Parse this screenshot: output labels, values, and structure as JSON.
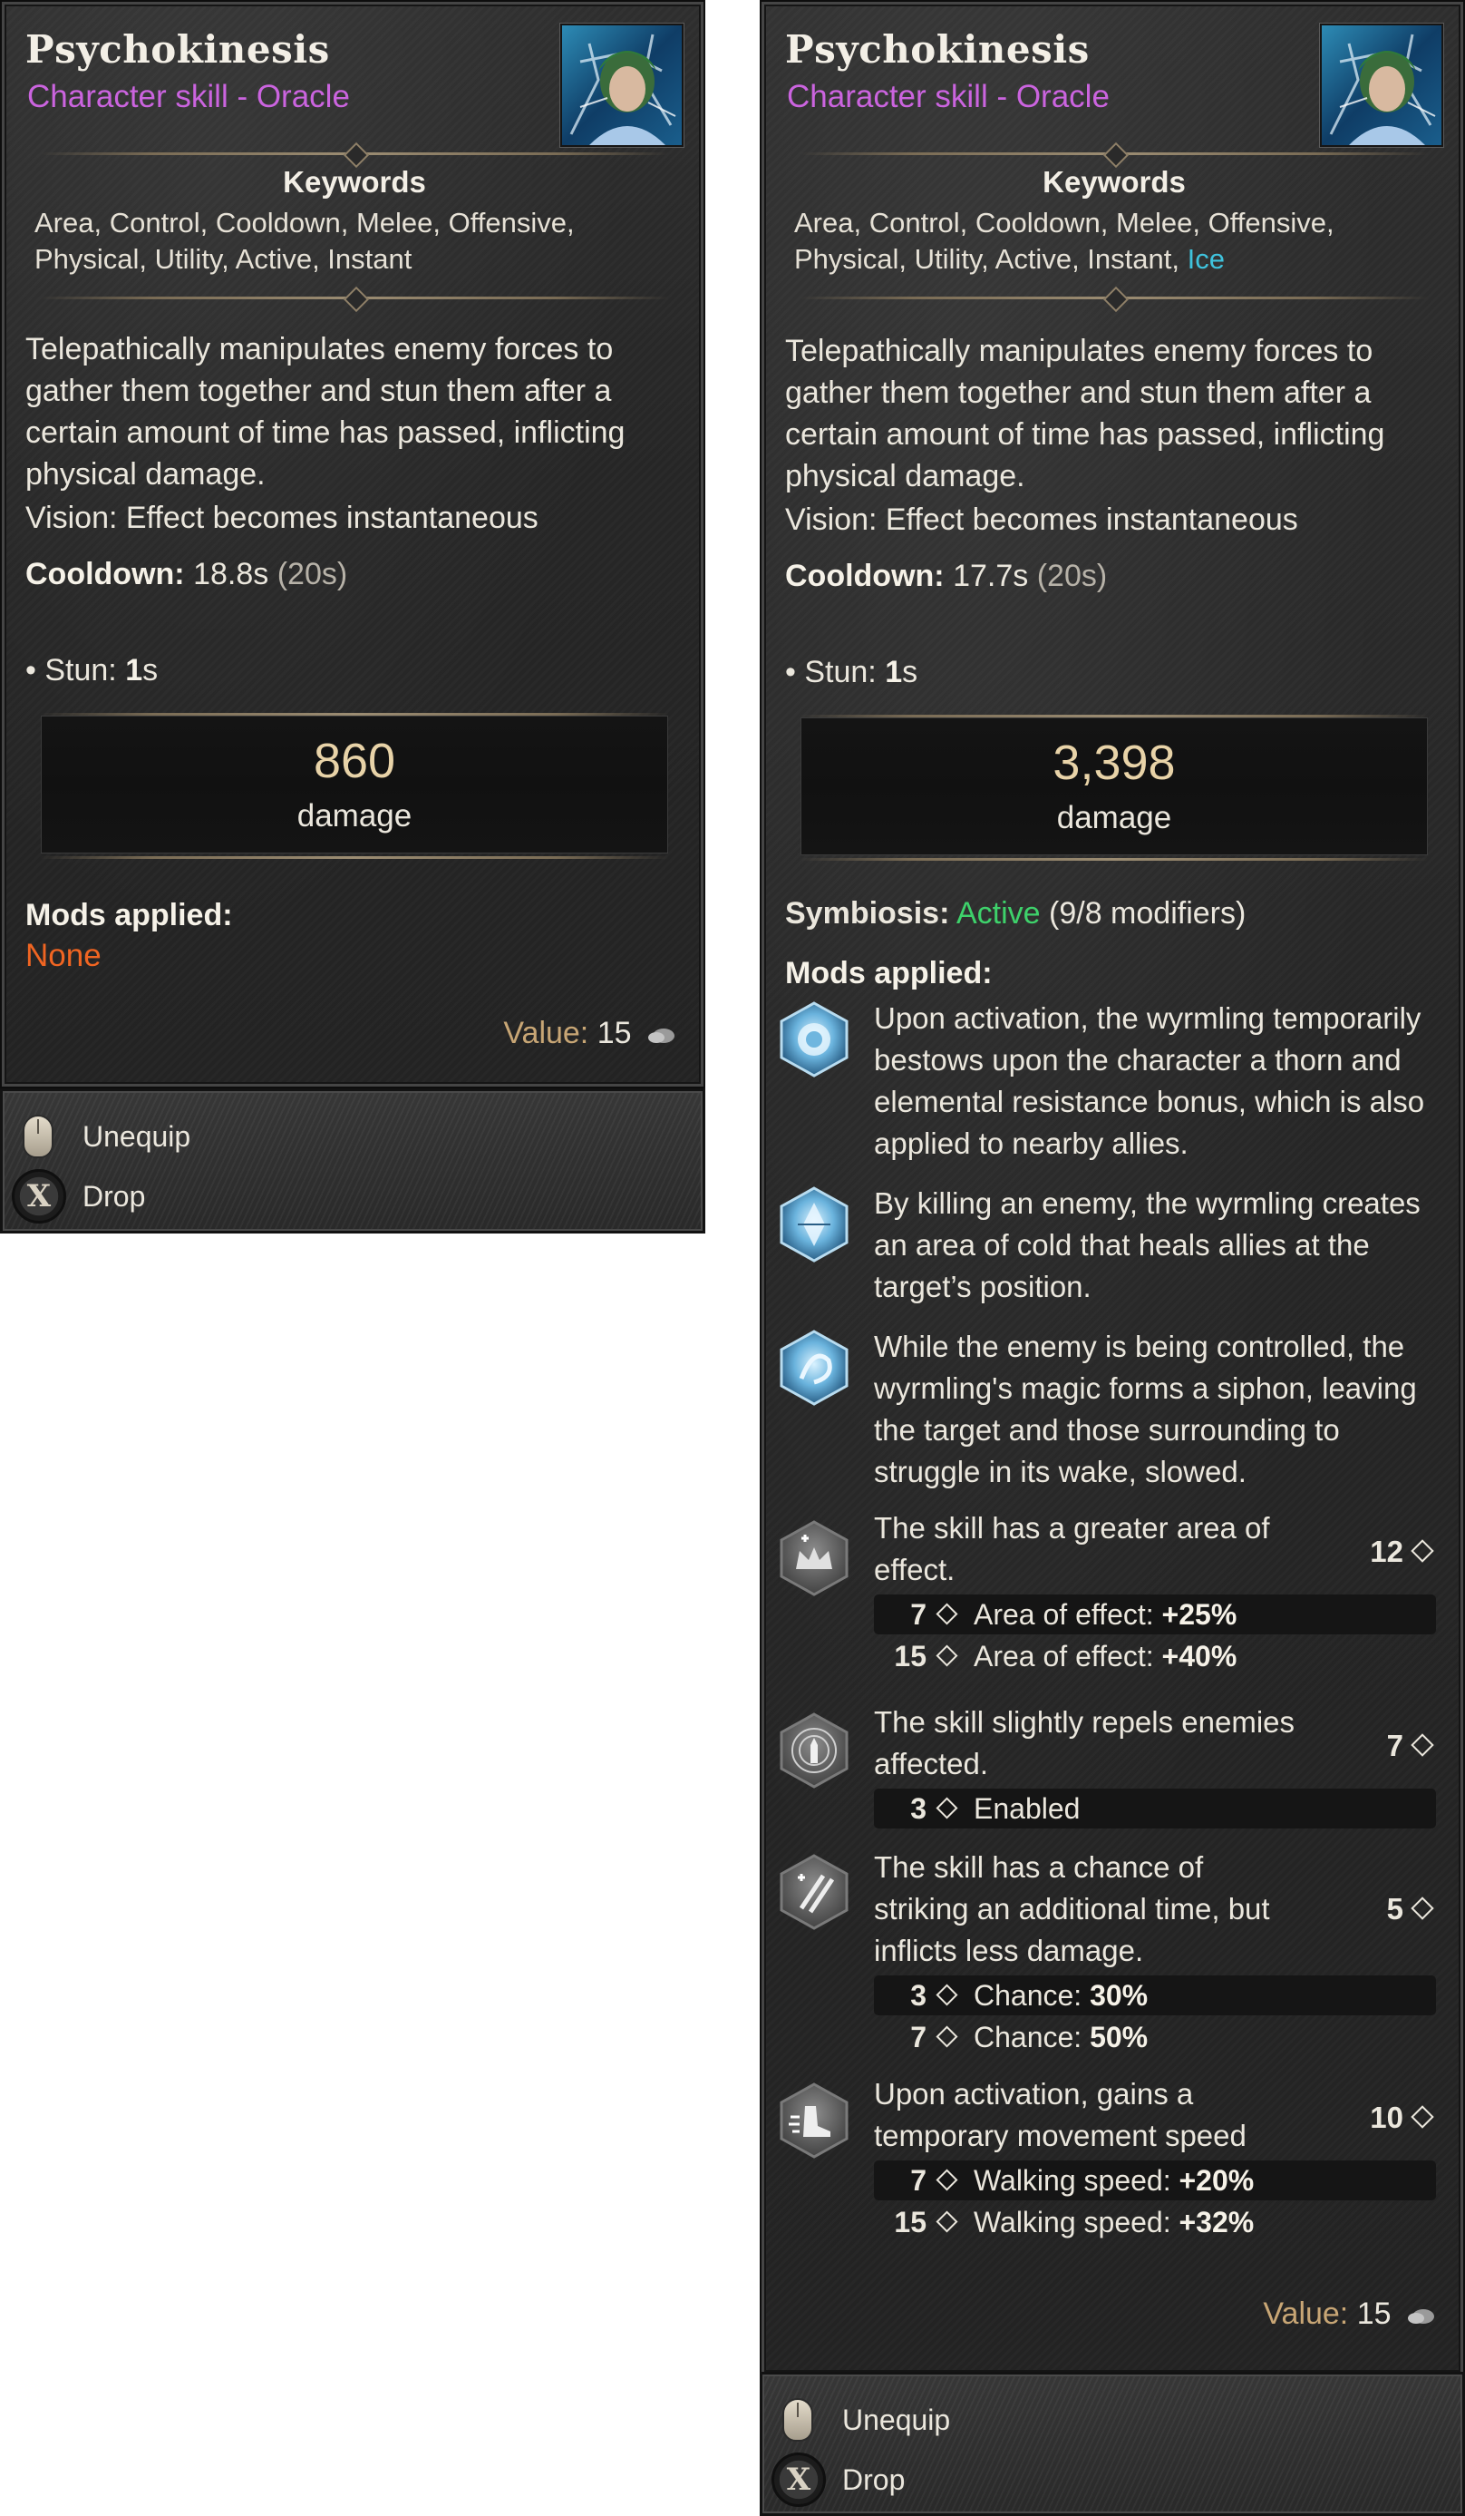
{
  "left": {
    "title": "Psychokinesis",
    "subtitle": "Character skill - Oracle",
    "keywords_heading": "Keywords",
    "keywords": "Area, Control, Cooldown, Melee, Offensive, Physical, Utility, Active, Instant",
    "description": "Telepathically manipulates enemy forces to gather them together and stun them after a certain amount of time has passed, inflicting physical damage.",
    "vision": "Vision: Effect becomes instantaneous",
    "cooldown_label": "Cooldown:",
    "cooldown_value": "18.8s",
    "cooldown_base": "(20s)",
    "stun_label": "• Stun:",
    "stun_value": "1",
    "stun_unit": "s",
    "damage_value": "860",
    "damage_label": "damage",
    "mods_heading": "Mods applied:",
    "mods_none": "None",
    "value_label": "Value:",
    "value_amount": "15",
    "actions": {
      "unequip": "Unequip",
      "drop": "Drop",
      "drop_key": "X"
    }
  },
  "right": {
    "title": "Psychokinesis",
    "subtitle": "Character skill - Oracle",
    "keywords_heading": "Keywords",
    "keywords": "Area, Control, Cooldown, Melee, Offensive, Physical, Utility, Active, Instant, ",
    "keyword_ice": "Ice",
    "description": "Telepathically manipulates enemy forces to gather them together and stun them after a certain amount of time has passed, inflicting physical damage.",
    "vision": "Vision: Effect becomes instantaneous",
    "cooldown_label": "Cooldown:",
    "cooldown_value": "17.7s",
    "cooldown_base": "(20s)",
    "stun_label": "• Stun:",
    "stun_value": "1",
    "stun_unit": "s",
    "damage_value": "3,398",
    "damage_label": "damage",
    "symbiosis_label": "Symbiosis:",
    "symbiosis_status": "Active",
    "symbiosis_count": "(9/8 modifiers)",
    "mods_heading": "Mods applied:",
    "mods": [
      {
        "icon": "frost-orb-icon",
        "text": "Upon activation, the wyrmling temporarily bestows upon the character a thorn and elemental resistance bonus, which is also applied to nearby allies."
      },
      {
        "icon": "frost-crystal-icon",
        "text": "By killing an enemy, the wyrmling creates an area of cold that heals allies at the target’s position."
      },
      {
        "icon": "ice-siphon-icon",
        "text": "While the enemy is being controlled, the wyrmling's magic forms a siphon, leaving the target and those surrounding to struggle in its wake, slowed."
      },
      {
        "icon": "area-crown-icon",
        "text": "The skill has a greater area of effect.",
        "rank": "12",
        "tiers": [
          {
            "num": "7",
            "label": "Area of effect:",
            "value": "+25%"
          },
          {
            "num": "15",
            "label": "Area of effect:",
            "value": "+40%"
          }
        ]
      },
      {
        "icon": "repel-hand-icon",
        "text": "The skill slightly repels enemies affected.",
        "rank": "7",
        "tiers": [
          {
            "num": "3",
            "label": "Enabled",
            "value": ""
          }
        ]
      },
      {
        "icon": "double-strike-icon",
        "text": "The skill has a chance of striking an additional time, but inflicts less damage.",
        "rank": "5",
        "tiers": [
          {
            "num": "3",
            "label": "Chance:",
            "value": "30%"
          },
          {
            "num": "7",
            "label": "Chance:",
            "value": "50%"
          }
        ]
      },
      {
        "icon": "speed-boot-icon",
        "text": "Upon activation, gains a temporary movement speed bonus.",
        "rank": "10",
        "tiers": [
          {
            "num": "7",
            "label": "Walking speed:",
            "value": "+20%"
          },
          {
            "num": "15",
            "label": "Walking speed:",
            "value": "+32%"
          }
        ]
      }
    ],
    "value_label": "Value:",
    "value_amount": "15",
    "actions": {
      "unequip": "Unequip",
      "drop": "Drop",
      "drop_key": "X"
    }
  }
}
